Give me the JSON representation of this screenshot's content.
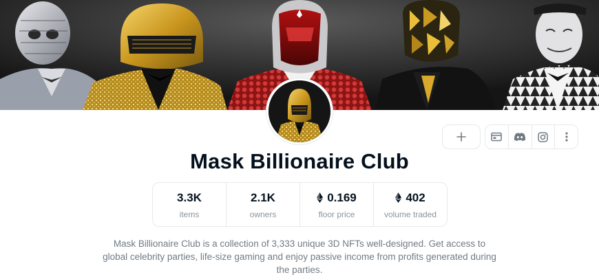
{
  "collection": {
    "name": "Mask Billionaire Club",
    "description": "Mask Billionaire Club is a collection of 3,333 unique 3D NFTs well-designed. Get access to global celebrity parties, life-size gaming and enjoy passive income from profits generated during the parties."
  },
  "stats": [
    {
      "value": "3.3K",
      "label": "items",
      "icon": ""
    },
    {
      "value": "2.1K",
      "label": "owners",
      "icon": ""
    },
    {
      "value": "0.169",
      "label": "floor price",
      "icon": "ethereum-icon"
    },
    {
      "value": "402",
      "label": "volume traded",
      "icon": "ethereum-icon"
    }
  ],
  "actions": {
    "add_icon": "plus-icon",
    "links": [
      "website-icon",
      "discord-icon",
      "instagram-icon",
      "more-icon"
    ]
  },
  "colors": {
    "text_primary": "#04111d",
    "text_secondary": "#707a83",
    "border": "#e5e8eb"
  }
}
